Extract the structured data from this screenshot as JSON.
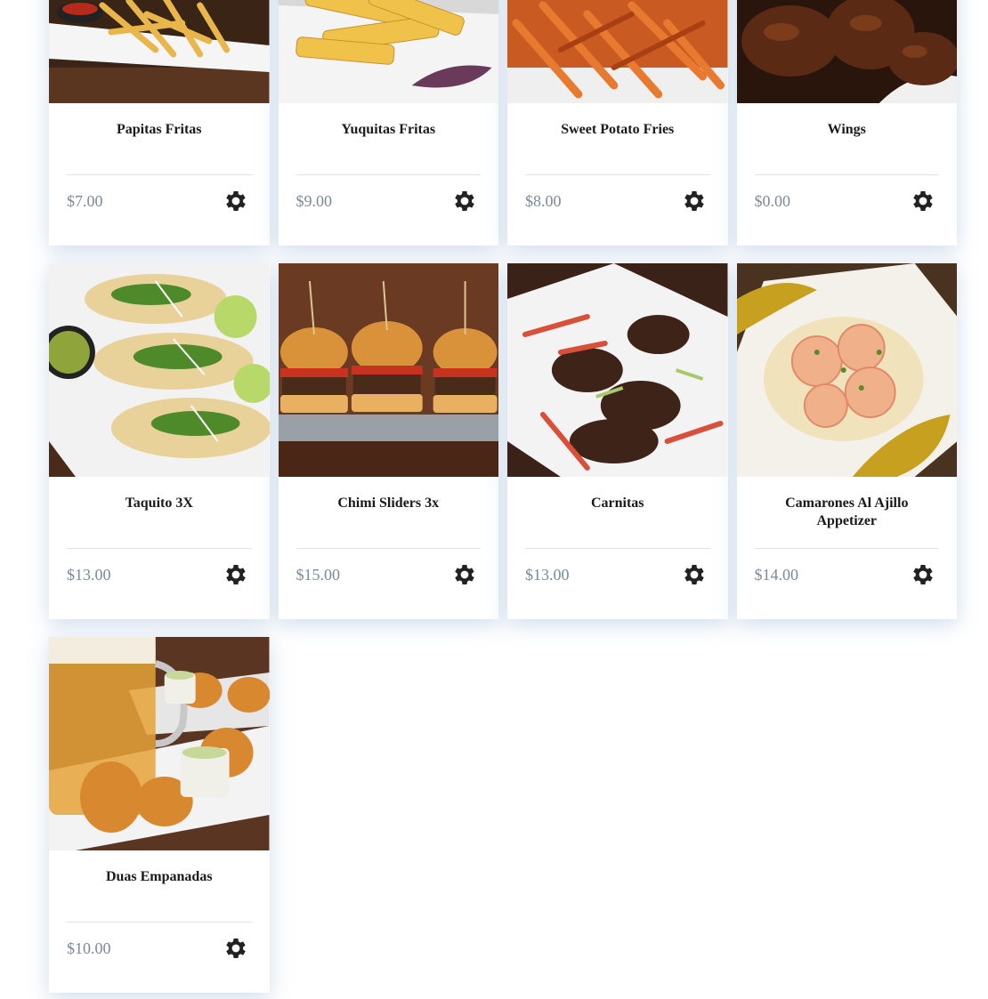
{
  "icons": {
    "options": "gear-icon"
  },
  "colors": {
    "price": "#7b8a99",
    "title": "#1a1a1a",
    "gear": "#222222"
  },
  "menu": {
    "items": [
      {
        "name": "Papitas Fritas",
        "price": "$7.00",
        "photo": "fries-icon"
      },
      {
        "name": "Yuquitas Fritas",
        "price": "$9.00",
        "photo": "yuca-fries-icon"
      },
      {
        "name": "Sweet Potato Fries",
        "price": "$8.00",
        "photo": "sweet-potato-fries-icon"
      },
      {
        "name": "Wings",
        "price": "$0.00",
        "photo": "wings-icon"
      },
      {
        "name": "Taquito 3X",
        "price": "$13.00",
        "photo": "tacos-icon"
      },
      {
        "name": "Chimi Sliders 3x",
        "price": "$15.00",
        "photo": "sliders-icon"
      },
      {
        "name": "Carnitas",
        "price": "$13.00",
        "photo": "carnitas-icon"
      },
      {
        "name": "Camarones Al Ajillo Appetizer",
        "price": "$14.00",
        "photo": "shrimp-icon"
      },
      {
        "name": "Duas Empanadas",
        "price": "$10.00",
        "photo": "empanadas-icon"
      }
    ]
  }
}
